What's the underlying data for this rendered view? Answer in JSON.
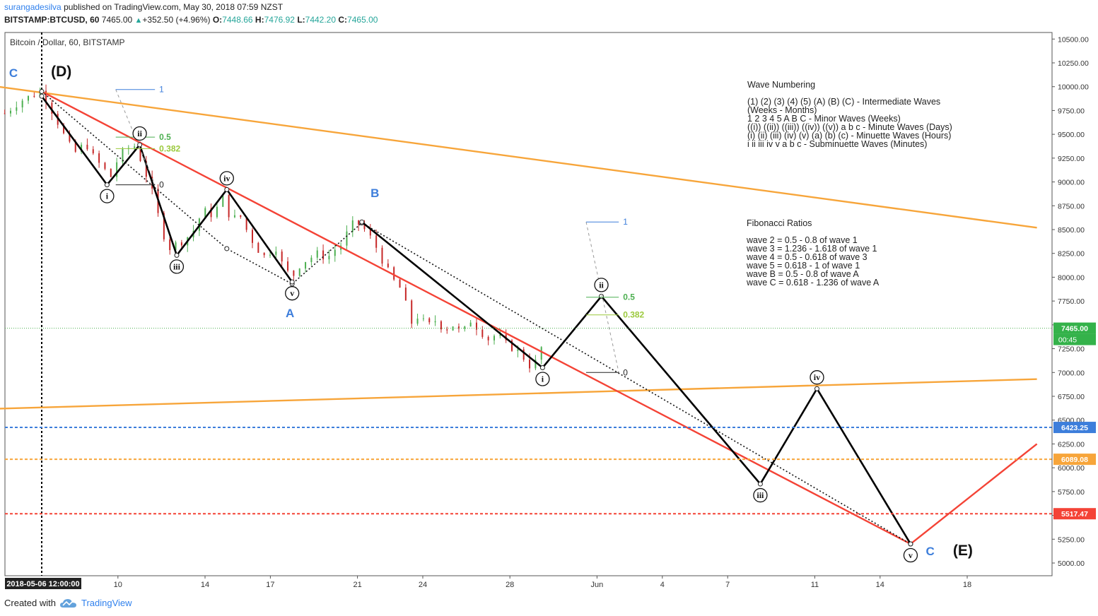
{
  "header": {
    "publisher": "surangadesilva",
    "published_text": "published on TradingView.com, May 30, 2018 07:59 NZST",
    "symbol": "BITSTAMP:BTCUSD, 60",
    "last": "7465.00",
    "change": "+352.50 (+4.96%)",
    "open_label": "O:",
    "open": "7448.66",
    "high_label": "H:",
    "high": "7476.92",
    "low_label": "L:",
    "low": "7442.20",
    "close_label": "C:",
    "close": "7465.00"
  },
  "footer": {
    "created_with": "Created with",
    "brand": "TradingView"
  },
  "colors": {
    "up": "#26a69a",
    "down": "#ef5350",
    "candle_up": "#4caf50",
    "candle_down": "#c62828",
    "orange": "#f7a53a",
    "red_line": "#f44336",
    "blue": "#3d7edb",
    "fib_green": "#4caf50",
    "fib_lime": "#9bc93c",
    "price_tag": "#34b24a"
  },
  "chart_data": {
    "type": "candlestick",
    "title": "Bitcoin / Dollar, 60, BITSTAMP",
    "ylim": [
      4900,
      10600
    ],
    "y_ticks": [
      5000,
      5250,
      5500,
      5750,
      6000,
      6250,
      6500,
      6750,
      7000,
      7250,
      7500,
      7750,
      8000,
      8250,
      8500,
      8750,
      9000,
      9250,
      9500,
      9750,
      10000,
      10250,
      10500
    ],
    "x_labels": [
      {
        "t": "2018-05-06 12:00:00",
        "day": 0,
        "highlight": true
      },
      {
        "t": "10",
        "day": 3.5
      },
      {
        "t": "14",
        "day": 7.5
      },
      {
        "t": "17",
        "day": 10.5
      },
      {
        "t": "21",
        "day": 14.5
      },
      {
        "t": "24",
        "day": 17.5
      },
      {
        "t": "28",
        "day": 21.5
      },
      {
        "t": "Jun",
        "day": 25.5
      },
      {
        "t": "4",
        "day": 28.5
      },
      {
        "t": "7",
        "day": 31.5
      },
      {
        "t": "11",
        "day": 35.5
      },
      {
        "t": "14",
        "day": 38.5
      },
      {
        "t": "18",
        "day": 42.5
      }
    ],
    "price_path": [
      [
        -1.7,
        9720
      ],
      [
        -1.0,
        9850
      ],
      [
        -0.5,
        9900
      ],
      [
        0,
        9960
      ],
      [
        0.4,
        9780
      ],
      [
        0.8,
        9600
      ],
      [
        1.2,
        9400
      ],
      [
        1.6,
        9300
      ],
      [
        2.0,
        9420
      ],
      [
        2.4,
        9250
      ],
      [
        2.8,
        9150
      ],
      [
        3.2,
        9050
      ],
      [
        3.5,
        9250
      ],
      [
        3.9,
        9350
      ],
      [
        4.3,
        9380
      ],
      [
        4.6,
        9200
      ],
      [
        5.0,
        8950
      ],
      [
        5.4,
        8600
      ],
      [
        5.8,
        8300
      ],
      [
        6.2,
        8350
      ],
      [
        6.6,
        8400
      ],
      [
        7.0,
        8500
      ],
      [
        7.4,
        8700
      ],
      [
        7.9,
        8650
      ],
      [
        8.3,
        8850
      ],
      [
        8.7,
        8600
      ],
      [
        9.1,
        8650
      ],
      [
        9.5,
        8450
      ],
      [
        9.9,
        8300
      ],
      [
        10.3,
        8200
      ],
      [
        10.7,
        8350
      ],
      [
        11.1,
        8100
      ],
      [
        11.5,
        8000
      ],
      [
        11.9,
        8150
      ],
      [
        12.3,
        8200
      ],
      [
        12.7,
        8250
      ],
      [
        13.1,
        8200
      ],
      [
        13.5,
        8300
      ],
      [
        13.8,
        8350
      ],
      [
        14.2,
        8550
      ],
      [
        14.6,
        8560
      ],
      [
        15.0,
        8450
      ],
      [
        15.4,
        8300
      ],
      [
        15.8,
        8100
      ],
      [
        16.2,
        7950
      ],
      [
        16.6,
        7850
      ],
      [
        16.9,
        7500
      ],
      [
        17.3,
        7600
      ],
      [
        17.7,
        7480
      ],
      [
        18.1,
        7550
      ],
      [
        18.5,
        7450
      ],
      [
        18.9,
        7500
      ],
      [
        19.3,
        7400
      ],
      [
        19.7,
        7550
      ],
      [
        20.1,
        7450
      ],
      [
        20.5,
        7350
      ],
      [
        20.9,
        7400
      ],
      [
        21.3,
        7300
      ],
      [
        21.7,
        7250
      ],
      [
        22.0,
        7200
      ],
      [
        22.3,
        7100
      ],
      [
        22.5,
        7050
      ],
      [
        22.8,
        7150
      ],
      [
        23.0,
        7300
      ],
      [
        23.2,
        7465
      ]
    ],
    "series": [
      {
        "name": "Resistance",
        "color": "#f7a53a",
        "points": [
          [
            -2.0,
            10000
          ],
          [
            45.7,
            8520
          ]
        ]
      },
      {
        "name": "Support",
        "color": "#f7a53a",
        "points": [
          [
            -2.0,
            6620
          ],
          [
            45.7,
            6930
          ]
        ]
      },
      {
        "name": "Channel",
        "color": "#f44336",
        "points": [
          [
            0,
            9950
          ],
          [
            39.9,
            5200
          ],
          [
            45.7,
            6250
          ]
        ]
      },
      {
        "name": "Dotted",
        "color": "#111111",
        "points": [
          [
            0,
            9950
          ],
          [
            8.5,
            8300
          ],
          [
            11.5,
            7930
          ],
          [
            14.7,
            8570
          ],
          [
            39.9,
            5200
          ]
        ]
      },
      {
        "name": "Wave1",
        "color": "#000000",
        "points": [
          [
            0,
            9900
          ],
          [
            3.0,
            8970
          ],
          [
            4.5,
            9390
          ],
          [
            6.2,
            8230
          ],
          [
            8.5,
            8920
          ],
          [
            11.5,
            7950
          ]
        ]
      },
      {
        "name": "Wave2",
        "color": "#000000",
        "points": [
          [
            14.7,
            8580
          ],
          [
            23.0,
            7050
          ],
          [
            25.7,
            7800
          ],
          [
            33.0,
            5830
          ],
          [
            35.6,
            6830
          ],
          [
            39.9,
            5200
          ]
        ]
      }
    ],
    "wave_labels": [
      {
        "t": "i",
        "day": 3.0,
        "price": 8970,
        "below": true
      },
      {
        "t": "ii",
        "day": 4.5,
        "price": 9390,
        "below": false
      },
      {
        "t": "iii",
        "day": 6.2,
        "price": 8230,
        "below": true
      },
      {
        "t": "iv",
        "day": 8.5,
        "price": 8920,
        "below": false
      },
      {
        "t": "v",
        "day": 11.5,
        "price": 7950,
        "below": true
      },
      {
        "t": "i",
        "day": 23.0,
        "price": 7050,
        "below": true
      },
      {
        "t": "ii",
        "day": 25.7,
        "price": 7800,
        "below": false
      },
      {
        "t": "iii",
        "day": 33.0,
        "price": 5830,
        "below": true
      },
      {
        "t": "iv",
        "day": 35.6,
        "price": 6830,
        "below": false
      },
      {
        "t": "v",
        "day": 39.9,
        "price": 5200,
        "below": true
      }
    ],
    "letters": [
      {
        "t": "C",
        "day": -1.3,
        "price": 10100,
        "kind": "blue"
      },
      {
        "t": "(D)",
        "day": 0.9,
        "price": 10110,
        "kind": "black"
      },
      {
        "t": "A",
        "day": 11.4,
        "price": 7580,
        "kind": "blue"
      },
      {
        "t": "B",
        "day": 15.3,
        "price": 8840,
        "kind": "blue"
      },
      {
        "t": "C",
        "day": 40.8,
        "price": 5080,
        "kind": "blue"
      },
      {
        "t": "(E)",
        "day": 42.3,
        "price": 5080,
        "kind": "black"
      }
    ],
    "fib_sets": [
      {
        "day0": 3.4,
        "day1": 5.2,
        "p0": 8970,
        "p1": 9970,
        "levels": [
          {
            "t": "0",
            "price": 8970
          },
          {
            "t": "0.382",
            "price": 9350
          },
          {
            "t": "0.5",
            "price": 9470
          },
          {
            "t": "1",
            "price": 9970
          }
        ],
        "diag": [
          [
            3.4,
            9970
          ],
          [
            5.2,
            8970
          ]
        ]
      },
      {
        "day0": 25.0,
        "day1": 26.5,
        "p0": 7000,
        "p1": 8580,
        "levels": [
          {
            "t": "0",
            "price": 7000
          },
          {
            "t": "0.382",
            "price": 7605
          },
          {
            "t": "0.5",
            "price": 7790
          },
          {
            "t": "1",
            "price": 8580
          }
        ],
        "diag": [
          [
            25.0,
            8580
          ],
          [
            26.5,
            7000
          ]
        ]
      }
    ],
    "hlines": [
      {
        "price": 7465,
        "color": "#4caf50",
        "dash": "1,2",
        "label": "7465.00",
        "sub": "00:45",
        "bg": "#34b24a"
      },
      {
        "price": 6423.25,
        "color": "#3d7edb",
        "dash": "4,3",
        "label": "6423.25",
        "bg": "#3d7edb"
      },
      {
        "price": 6089.08,
        "color": "#f7a53a",
        "dash": "4,3",
        "label": "6089.08",
        "bg": "#f7a53a"
      },
      {
        "price": 5517.47,
        "color": "#f44336",
        "dash": "4,3",
        "label": "5517.47",
        "bg": "#f44336"
      }
    ],
    "annotations": {
      "wave_numbering_title": "Wave Numbering",
      "wave_numbering": [
        "(1) (2) (3) (4) (5) (A) (B) (C) - Intermediate Waves",
        "(Weeks - Months)",
        "1 2 3 4 5 A B C - Minor Waves (Weeks)",
        "((i)) ((ii)) ((iii)) ((iv)) ((v)) a b c - Minute Waves (Days)",
        "(i) (ii) (iii) (iv) (v) (a) (b) (c) - Minuette Waves (Hours)",
        "i ii iii iv v a b c - Subminuette Waves (Minutes)"
      ],
      "fib_title": "Fibonacci Ratios",
      "fib_ratios": [
        "wave 2 = 0.5 - 0.8 of wave 1",
        "wave 3 = 1.236 - 1.618 of wave 1",
        "wave 4 = 0.5 - 0.618 of wave 3",
        "wave 5 = 0.618 - 1 of wave 1",
        "wave B = 0.5 - 0.8 of wave A",
        "wave C = 0.618 - 1.236 of wave A"
      ]
    }
  }
}
